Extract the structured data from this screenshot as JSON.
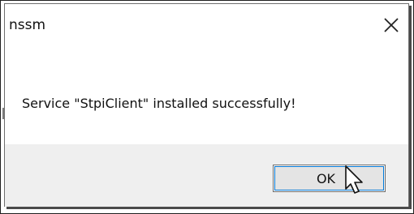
{
  "window": {
    "title": "nssm",
    "close_icon": "close-icon"
  },
  "dialog": {
    "message": "Service \"StpiClient\" installed successfully!"
  },
  "buttons": {
    "ok_label": "OK"
  },
  "icons": {
    "cursor": "mouse-pointer-icon"
  },
  "colors": {
    "button_focus_border": "#0078d7",
    "button_bar_background": "#efefef"
  }
}
